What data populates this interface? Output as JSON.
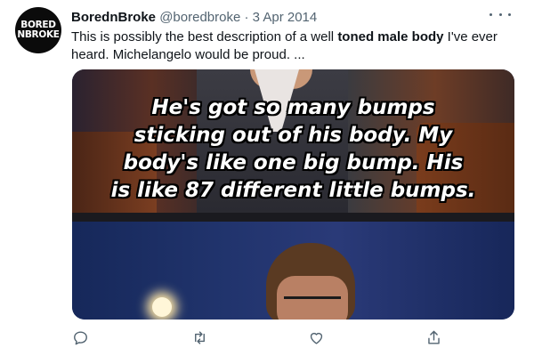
{
  "tweet": {
    "avatar": {
      "line1": "BORED",
      "line2": "NBROKE"
    },
    "display_name": "BorednBroke",
    "handle": "@boredbroke",
    "separator": "·",
    "date": "3 Apr 2014",
    "more_icon": "more-horizontal-icon",
    "text_parts": {
      "before": "This is possibly the best description of a well ",
      "bold": "toned male body",
      "after": " I've ever heard. Michelangelo would be proud. ..."
    },
    "media": {
      "caption_lines": [
        "He's got so many bumps",
        "sticking out of his body. My",
        "body's like one big bump. His",
        "is like 87 different little bumps."
      ]
    },
    "actions": [
      {
        "name": "reply",
        "icon": "reply-icon"
      },
      {
        "name": "retweet",
        "icon": "retweet-icon"
      },
      {
        "name": "like",
        "icon": "heart-icon"
      },
      {
        "name": "share",
        "icon": "share-icon"
      }
    ]
  },
  "colors": {
    "text": "#0f1419",
    "secondary": "#536471",
    "avatar_bg": "#0b0b0b"
  }
}
